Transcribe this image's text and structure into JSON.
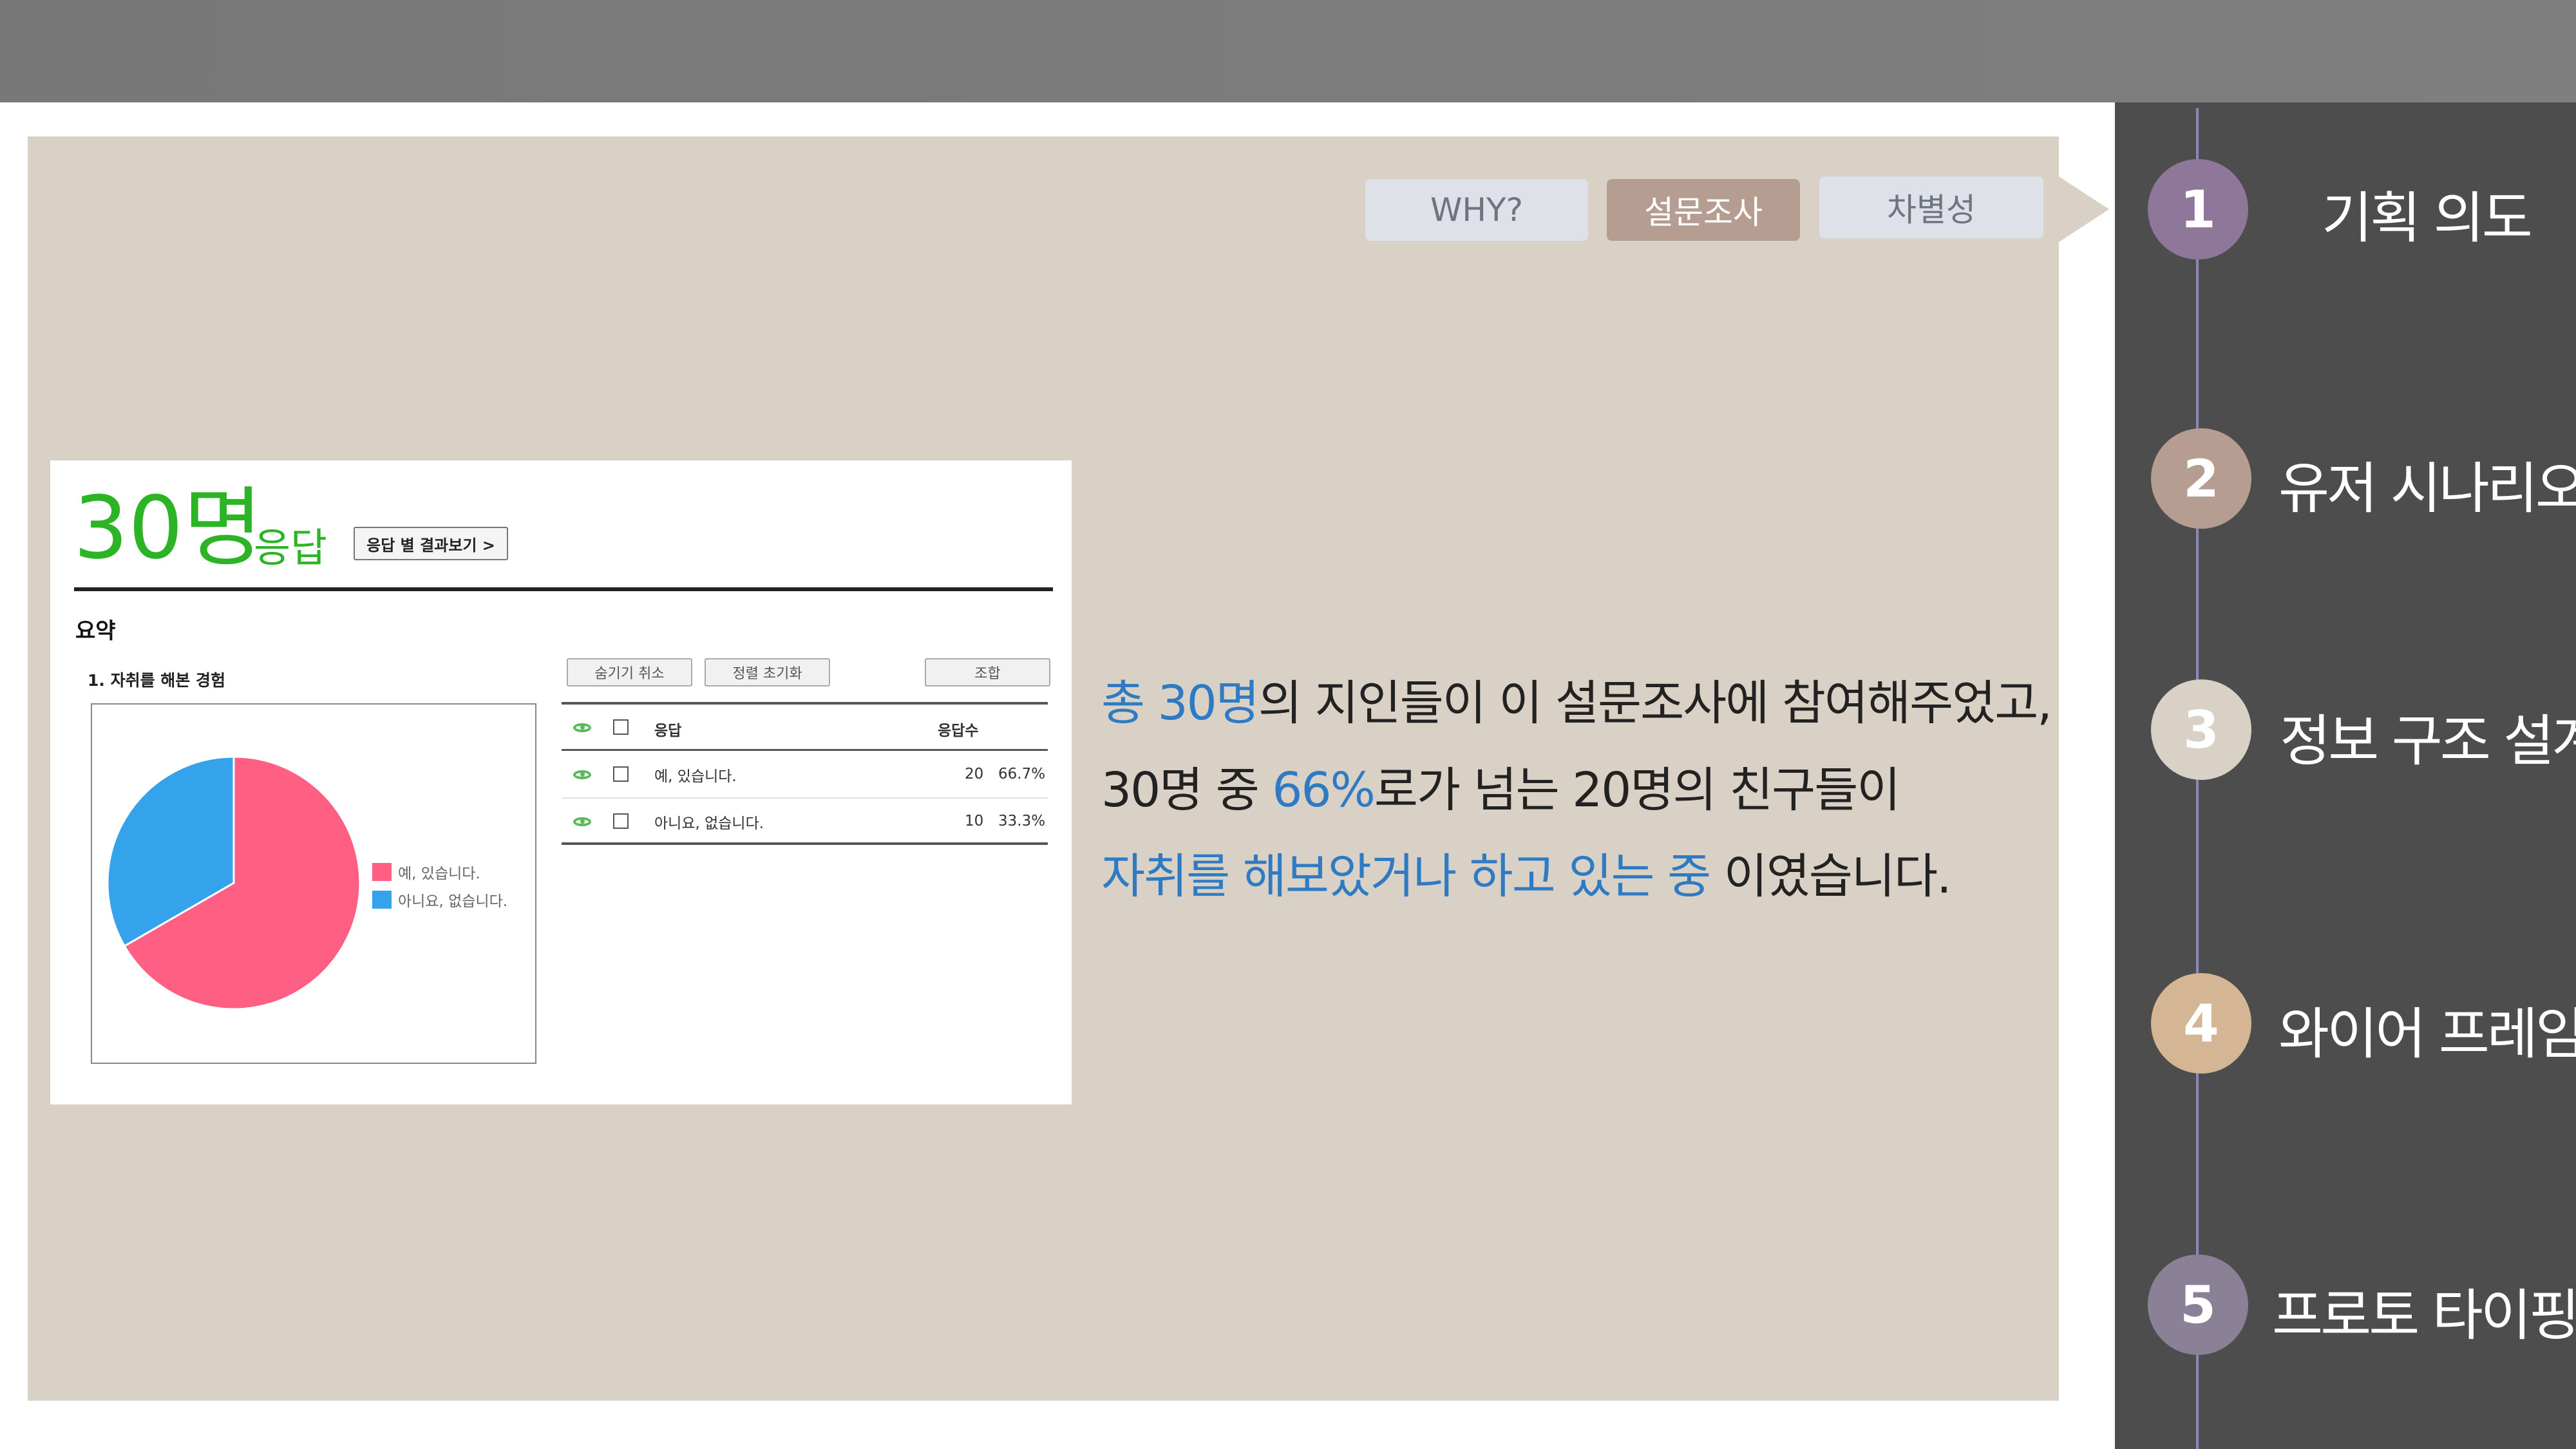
{
  "tabs": {
    "why": "WHY?",
    "survey": "설문조사",
    "difference": "차별성"
  },
  "survey": {
    "count": "30명",
    "count_label": "응답",
    "by_answer_button": "응답 별 결과보기 >",
    "summary_title": "요약",
    "question_title": "1. 자취를 해본 경험",
    "buttons": {
      "hide_cancel": "숨기기 취소",
      "reset_sort": "정렬 초기화",
      "combine": "조합"
    },
    "table": {
      "col_answer": "응답",
      "col_count": "응답수",
      "rows": [
        {
          "answer": "예, 있습니다.",
          "count": "20",
          "percent": "66.7%"
        },
        {
          "answer": "아니요, 없습니다.",
          "count": "10",
          "percent": "33.3%"
        }
      ]
    },
    "legend": [
      {
        "label": "예, 있습니다.",
        "color": "#ff5f82"
      },
      {
        "label": "아니요, 없습니다.",
        "color": "#35a3eb"
      }
    ]
  },
  "chart_data": {
    "type": "pie",
    "categories": [
      "예, 있습니다.",
      "아니요, 없습니다."
    ],
    "values": [
      20,
      10
    ],
    "colors": [
      "#ff5f82",
      "#35a3eb"
    ],
    "legend_position": "right"
  },
  "description": {
    "line1": {
      "hl": "총 30명",
      "rest": "의 지인들이 이 설문조사에 참여해주었고,"
    },
    "line2": {
      "pre": "30명 중 ",
      "hl": "66%",
      "rest": "로가 넘는 20명의 친구들이"
    },
    "line3": {
      "hl": "자취를 해보았거나 하고 있는 중",
      "rest": " 이였습니다."
    }
  },
  "steps": [
    {
      "number": "1",
      "label": "기획 의도",
      "color": "#8e7799"
    },
    {
      "number": "2",
      "label": "유저 시나리오",
      "color": "#b59d91"
    },
    {
      "number": "3",
      "label": "정보 구조 설계",
      "color": "#d9d0c6"
    },
    {
      "number": "4",
      "label": "와이어 프레임",
      "color": "#d4b594"
    },
    {
      "number": "5",
      "label": "프로토 타이핑",
      "color": "#8a8196"
    }
  ]
}
